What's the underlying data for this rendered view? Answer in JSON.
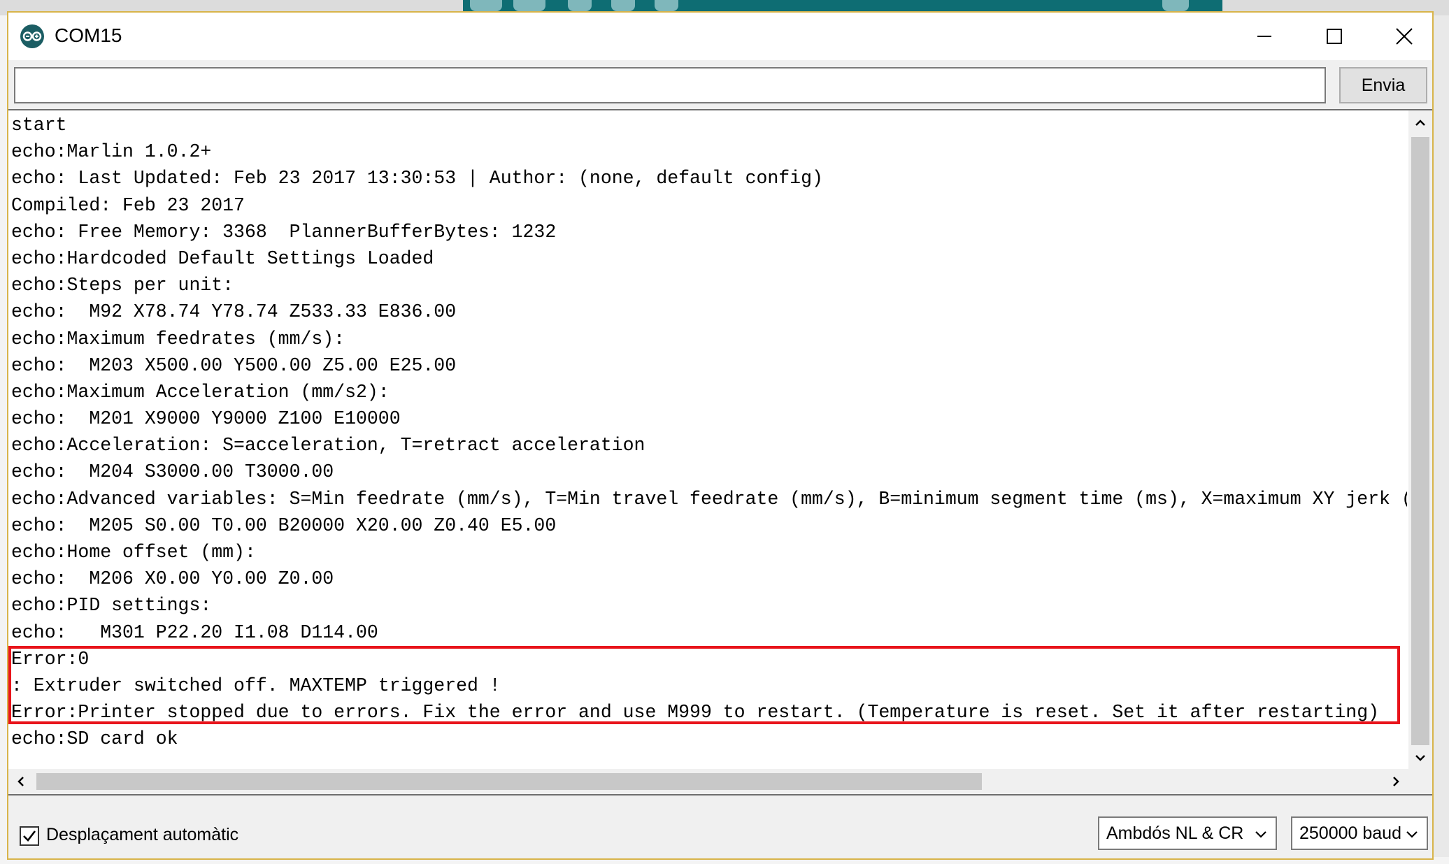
{
  "window": {
    "title": "COM15",
    "app_icon": "arduino-icon",
    "controls": [
      "minimize-icon",
      "maximize-icon",
      "close-icon"
    ]
  },
  "send": {
    "input_value": "",
    "button_label": "Envia"
  },
  "console": {
    "lines": [
      "start",
      "echo:Marlin 1.0.2+",
      "echo: Last Updated: Feb 23 2017 13:30:53 | Author: (none, default config)",
      "Compiled: Feb 23 2017",
      "echo: Free Memory: 3368  PlannerBufferBytes: 1232",
      "echo:Hardcoded Default Settings Loaded",
      "echo:Steps per unit:",
      "echo:  M92 X78.74 Y78.74 Z533.33 E836.00",
      "echo:Maximum feedrates (mm/s):",
      "echo:  M203 X500.00 Y500.00 Z5.00 E25.00",
      "echo:Maximum Acceleration (mm/s2):",
      "echo:  M201 X9000 Y9000 Z100 E10000",
      "echo:Acceleration: S=acceleration, T=retract acceleration",
      "echo:  M204 S3000.00 T3000.00",
      "echo:Advanced variables: S=Min feedrate (mm/s), T=Min travel feedrate (mm/s), B=minimum segment time (ms), X=maximum XY jerk (m",
      "echo:  M205 S0.00 T0.00 B20000 X20.00 Z0.40 E5.00",
      "echo:Home offset (mm):",
      "echo:  M206 X0.00 Y0.00 Z0.00",
      "echo:PID settings:",
      "echo:   M301 P22.20 I1.08 D114.00",
      "Error:0",
      ": Extruder switched off. MAXTEMP triggered !",
      "Error:Printer stopped due to errors. Fix the error and use M999 to restart. (Temperature is reset. Set it after restarting)",
      "echo:SD card ok"
    ],
    "highlight_color": "#e8141b"
  },
  "status": {
    "autoscroll_label": "Desplaçament automàtic",
    "autoscroll_checked": true,
    "line_ending": "Ambdós NL & CR",
    "baud_rate": "250000 baud"
  }
}
